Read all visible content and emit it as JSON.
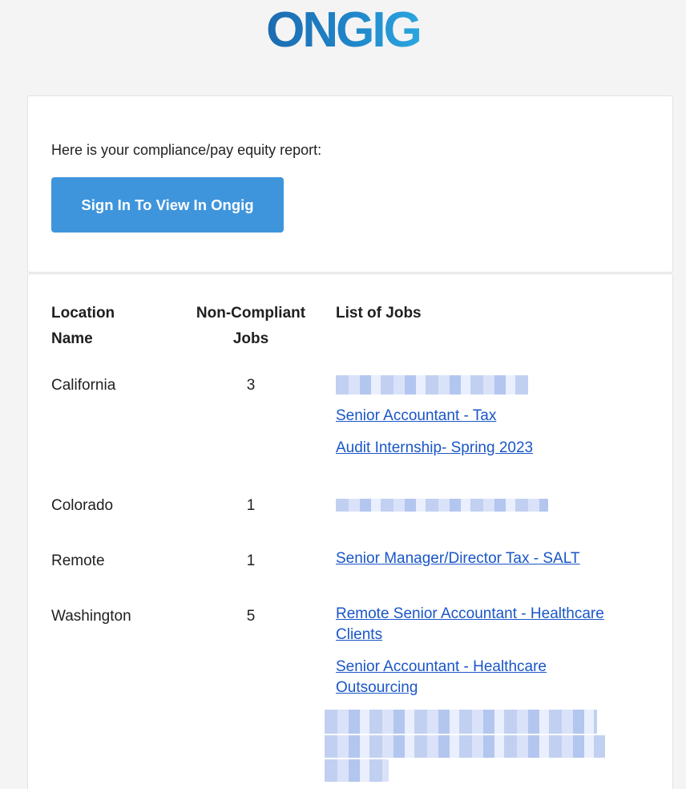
{
  "brand": {
    "logo_text": "ONGIG",
    "color_dark": "#1c6bb0",
    "color_light": "#2aa6df"
  },
  "intro": {
    "message": "Here is your compliance/pay equity report:",
    "signin_button": "Sign In To View In Ongig"
  },
  "report": {
    "headers": {
      "location": "Location Name",
      "count": "Non-Compliant Jobs",
      "jobs": "List of Jobs"
    },
    "rows": [
      {
        "location": "California",
        "count": "3",
        "jobs": [
          "Senior Accountant - Tax",
          "Audit Internship- Spring 2023"
        ]
      },
      {
        "location": "Colorado",
        "count": "1",
        "jobs": []
      },
      {
        "location": "Remote",
        "count": "1",
        "jobs": [
          "Senior Manager/Director Tax - SALT"
        ]
      },
      {
        "location": "Washington",
        "count": "5",
        "jobs": [
          "Remote Senior Accountant - Healthcare Clients",
          "Senior Accountant - Healthcare Outsourcing"
        ]
      }
    ]
  },
  "colors": {
    "button_bg": "#3f95dc",
    "link": "#1a56c7",
    "page_bg": "#f4f4f4"
  }
}
